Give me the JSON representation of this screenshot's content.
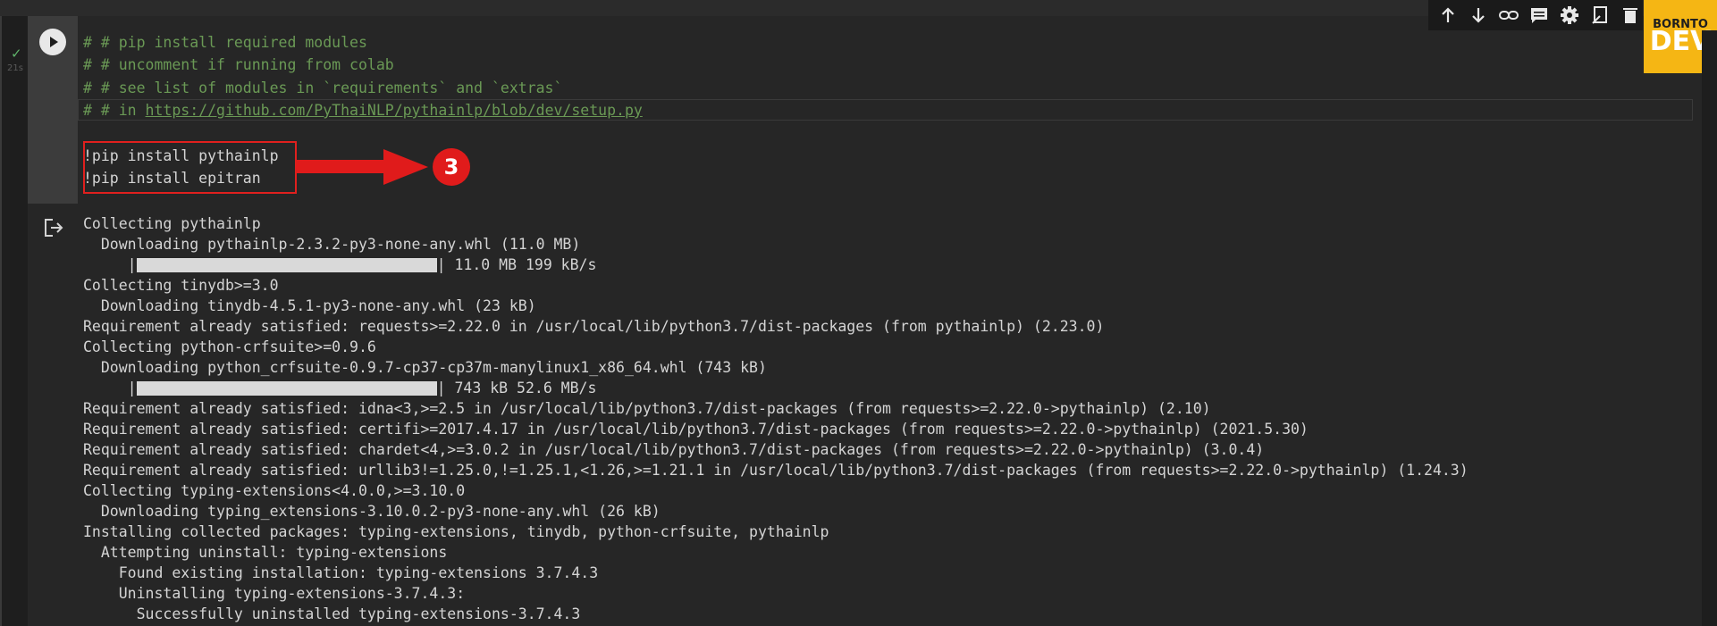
{
  "cell": {
    "status_icon": "check-icon",
    "run_time": "21s",
    "run_button_icon": "play-icon",
    "code_lines": [
      "# # pip install required modules",
      "# # uncomment if running from colab",
      "# # see list of modules in `requirements` and `extras`",
      "# # in "
    ],
    "link": "https://github.com/PyThaiNLP/pythainlp/blob/dev/setup.py",
    "commands": [
      "!pip install pythainlp",
      "!pip install epitran"
    ],
    "annotation_number": "3"
  },
  "toolbar": {
    "icons": [
      "arrow-up-icon",
      "arrow-down-icon",
      "link-icon",
      "comment-icon",
      "gear-icon",
      "mirror-cell-icon",
      "trash-icon"
    ]
  },
  "logo": {
    "top": "BORNTO",
    "bottom": "DEV"
  },
  "output": {
    "icon": "output-redirect-icon",
    "lines": [
      {
        "text": "Collecting pythainlp"
      },
      {
        "text": "  Downloading pythainlp-2.3.2-py3-none-any.whl (11.0 MB)"
      },
      {
        "bar": true,
        "text": "     |",
        "after": "| 11.0 MB 199 kB/s",
        "progress": 1.0
      },
      {
        "text": "Collecting tinydb>=3.0"
      },
      {
        "text": "  Downloading tinydb-4.5.1-py3-none-any.whl (23 kB)"
      },
      {
        "text": "Requirement already satisfied: requests>=2.22.0 in /usr/local/lib/python3.7/dist-packages (from pythainlp) (2.23.0)"
      },
      {
        "text": "Collecting python-crfsuite>=0.9.6"
      },
      {
        "text": "  Downloading python_crfsuite-0.9.7-cp37-cp37m-manylinux1_x86_64.whl (743 kB)"
      },
      {
        "bar": true,
        "text": "     |",
        "after": "| 743 kB 52.6 MB/s",
        "progress": 1.0
      },
      {
        "text": "Requirement already satisfied: idna<3,>=2.5 in /usr/local/lib/python3.7/dist-packages (from requests>=2.22.0->pythainlp) (2.10)"
      },
      {
        "text": "Requirement already satisfied: certifi>=2017.4.17 in /usr/local/lib/python3.7/dist-packages (from requests>=2.22.0->pythainlp) (2021.5.30)"
      },
      {
        "text": "Requirement already satisfied: chardet<4,>=3.0.2 in /usr/local/lib/python3.7/dist-packages (from requests>=2.22.0->pythainlp) (3.0.4)"
      },
      {
        "text": "Requirement already satisfied: urllib3!=1.25.0,!=1.25.1,<1.26,>=1.21.1 in /usr/local/lib/python3.7/dist-packages (from requests>=2.22.0->pythainlp) (1.24.3)"
      },
      {
        "text": "Collecting typing-extensions<4.0.0,>=3.10.0"
      },
      {
        "text": "  Downloading typing_extensions-3.10.0.2-py3-none-any.whl (26 kB)"
      },
      {
        "text": "Installing collected packages: typing-extensions, tinydb, python-crfsuite, pythainlp"
      },
      {
        "text": "  Attempting uninstall: typing-extensions"
      },
      {
        "text": "    Found existing installation: typing-extensions 3.7.4.3"
      },
      {
        "text": "    Uninstalling typing-extensions-3.7.4.3:"
      },
      {
        "text": "      Successfully uninstalled typing-extensions-3.7.4.3"
      }
    ]
  },
  "colors": {
    "comment": "#6a9955",
    "code": "#d4d4d4",
    "highlight": "#e0201e",
    "logo_bg": "#f5b614"
  }
}
